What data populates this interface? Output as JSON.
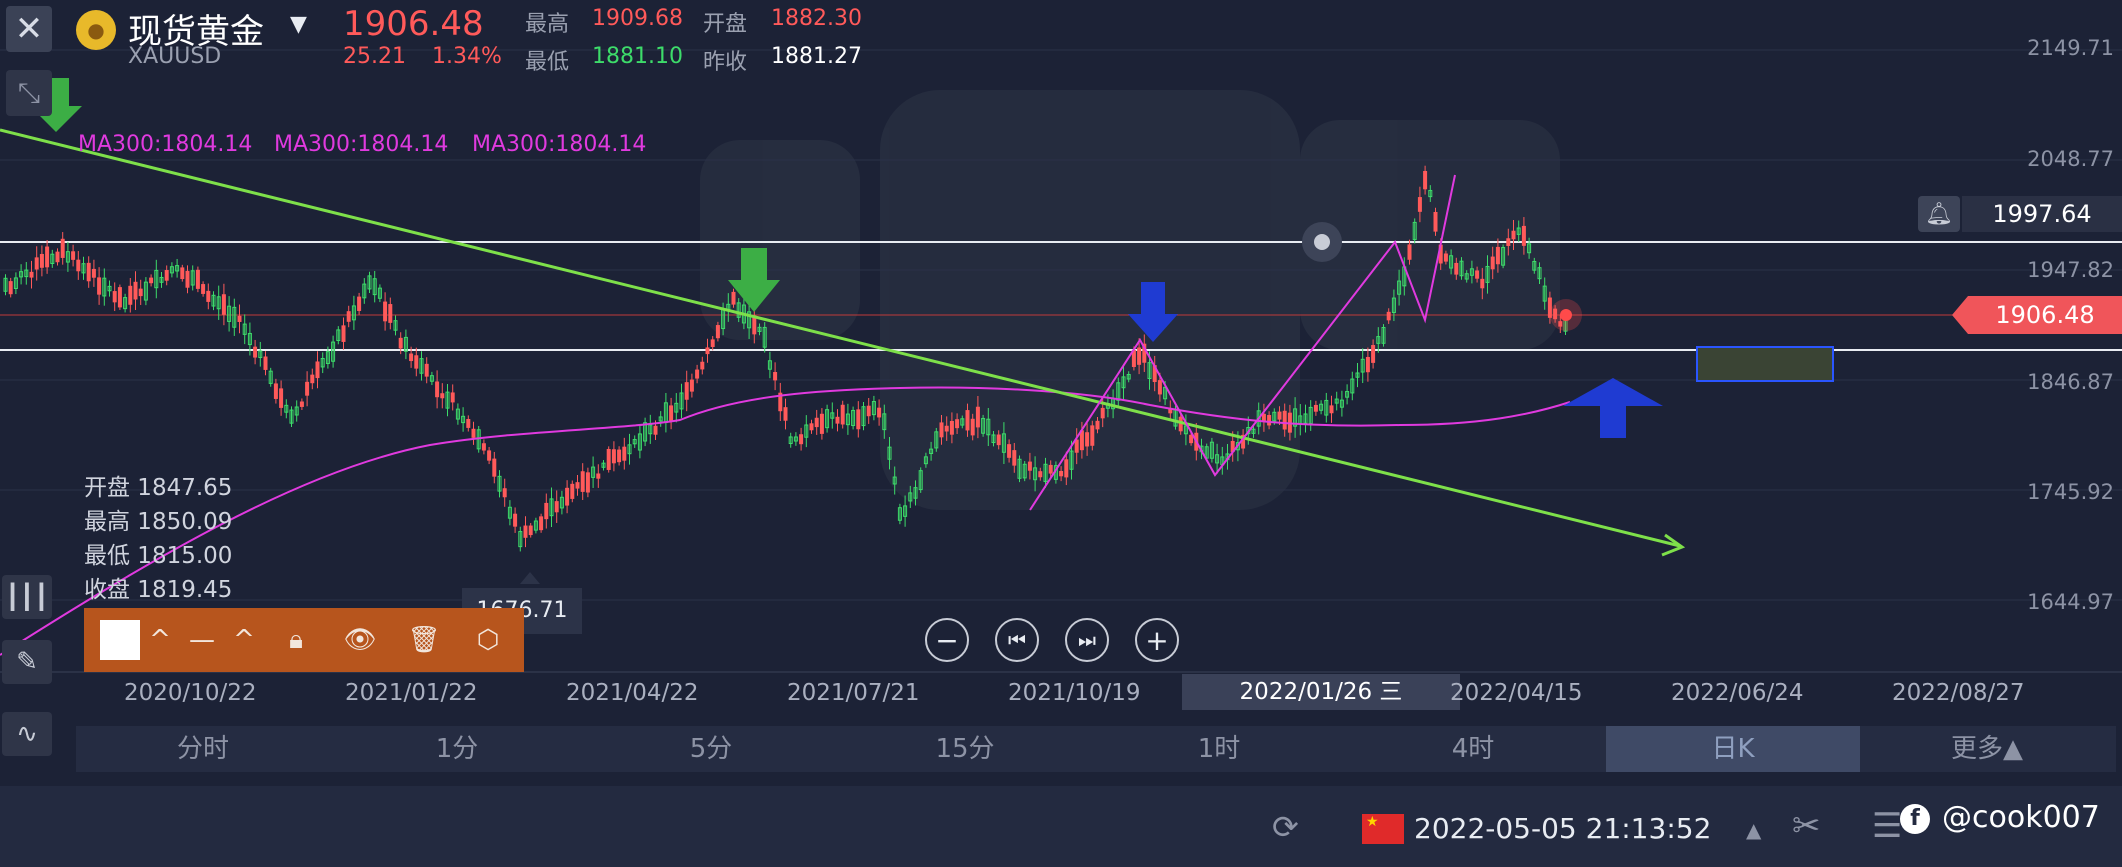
{
  "header": {
    "instrument_name": "现货黄金",
    "symbol": "XAUUSD",
    "last_price": "1906.48",
    "change": "25.21",
    "change_pct": "1.34%",
    "high_label": "最高",
    "high_value": "1909.68",
    "open_label": "开盘",
    "open_value": "1882.30",
    "low_label": "最低",
    "low_value": "1881.10",
    "prev_close_label": "昨收",
    "prev_close_value": "1881.27"
  },
  "ma_labels": [
    "MA300:1804.14",
    "MA300:1804.14",
    "MA300:1804.14"
  ],
  "y_axis": {
    "ticks": [
      "2149.71",
      "2048.77",
      "1947.82",
      "1846.87",
      "1745.92",
      "1644.97"
    ],
    "alert_price": "1997.64",
    "current_price": "1906.48"
  },
  "x_axis": {
    "ticks": [
      "2020/10/22",
      "2021/01/22",
      "2021/04/22",
      "2021/07/21",
      "2021/10/19",
      "2022/04/15",
      "2022/06/24",
      "2022/08/27"
    ],
    "cursor_date": "2022/01/26 三"
  },
  "ohlc_panel": {
    "open": "开盘 1847.65",
    "high": "最高 1850.09",
    "low": "最低 1815.00",
    "close": "收盘 1819.45"
  },
  "low_marker": "1676.71",
  "timeframes": [
    "分时",
    "1分",
    "5分",
    "15分",
    "1时",
    "4时",
    "日K",
    "更多▲"
  ],
  "active_timeframe": "日K",
  "status_bar": {
    "datetime": "2022-05-05 21:13:52",
    "watermark": "@cook007"
  },
  "colors": {
    "background": "#1c2236",
    "up": "#3ddc6a",
    "down": "#ff5a5a",
    "ma300": "#e03adf",
    "trendline": "#7ee04a",
    "price_tag": "#f0555a"
  },
  "icons": [
    "close-icon",
    "gold-coin-icon",
    "dropdown-icon",
    "collapse-icon",
    "bell-icon",
    "candlestick-icon",
    "pencil-icon",
    "indicator-icon",
    "zoom-out-icon",
    "step-back-icon",
    "step-forward-icon",
    "zoom-in-icon",
    "lock-icon",
    "eye-icon",
    "trash-icon",
    "settings-icon",
    "china-flag-icon",
    "tools-icon",
    "menu-icon",
    "facebook-icon"
  ]
}
